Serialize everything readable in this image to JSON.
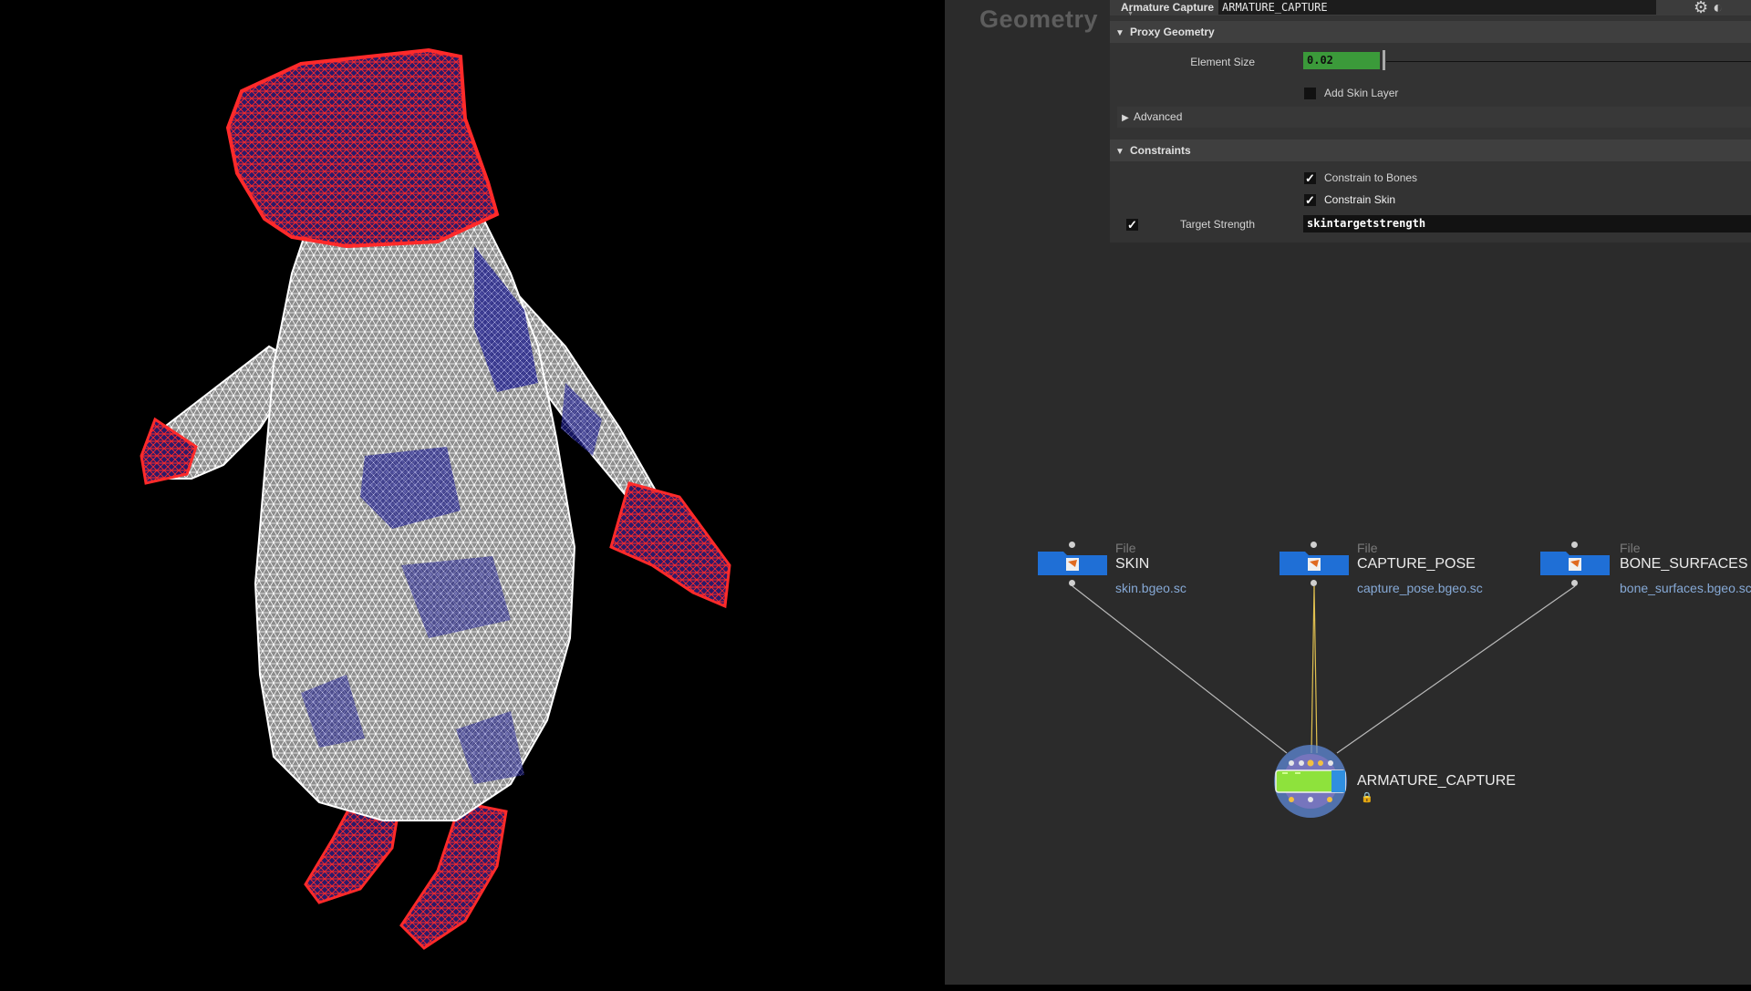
{
  "network": {
    "title": "Geometry"
  },
  "params": {
    "node_type": "Armature Capture",
    "node_name": "ARMATURE_CAPTURE",
    "sections": {
      "proxy": "Proxy Geometry",
      "advanced": "Advanced",
      "constraints": "Constraints"
    },
    "element_size": {
      "label": "Element Size",
      "value": "0.02",
      "fraction": 0.11
    },
    "add_skin_layer": {
      "label": "Add Skin Layer",
      "checked": false
    },
    "constrain_to_bones": {
      "label": "Constrain to Bones",
      "checked": true
    },
    "constrain_skin": {
      "label": "Constrain Skin",
      "checked": true
    },
    "target_strength": {
      "label": "Target Strength",
      "value": "skintargetstrength",
      "enabled": true
    }
  },
  "nodes": {
    "skin": {
      "type": "File",
      "name": "SKIN",
      "file": "skin.bgeo.sc"
    },
    "capture_pose": {
      "type": "File",
      "name": "CAPTURE_POSE",
      "file": "capture_pose.bgeo.sc"
    },
    "bone_surfaces": {
      "type": "File",
      "name": "BONE_SURFACES",
      "file": "bone_surfaces.bgeo.sc"
    },
    "armature_capture": {
      "name": "ARMATURE_CAPTURE"
    }
  },
  "colors": {
    "file_node": "#1f6fd6",
    "capture_node": "#8ee23c",
    "capture_halo": "#5f8ad8",
    "wire": "#b9b9b9",
    "wire_selected": "#e0c050",
    "mesh_white": "#ffffff",
    "mesh_red": "#ff2020",
    "mesh_blue": "#2a2ab8"
  },
  "icons": {
    "file_node": "file-node-icon",
    "header": "gear-icon",
    "lock": "lock-icon"
  }
}
